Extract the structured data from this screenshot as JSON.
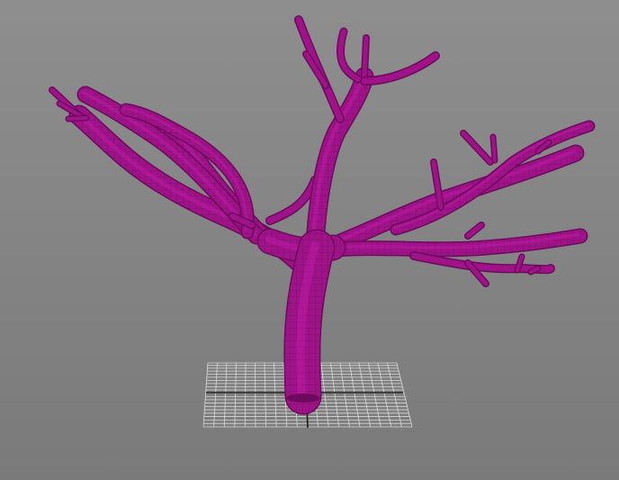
{
  "viewport": {
    "background_top": "#8e8e8e",
    "background_bottom": "#7a7a7a"
  },
  "tree": {
    "color": "#9e1488",
    "shade": "#6d0a5d",
    "highlight": "#c21aa8",
    "wire": "#5a0a4e"
  },
  "grid": {
    "line_color": "#d8d8d8",
    "axis_color": "#1a1a1a"
  }
}
